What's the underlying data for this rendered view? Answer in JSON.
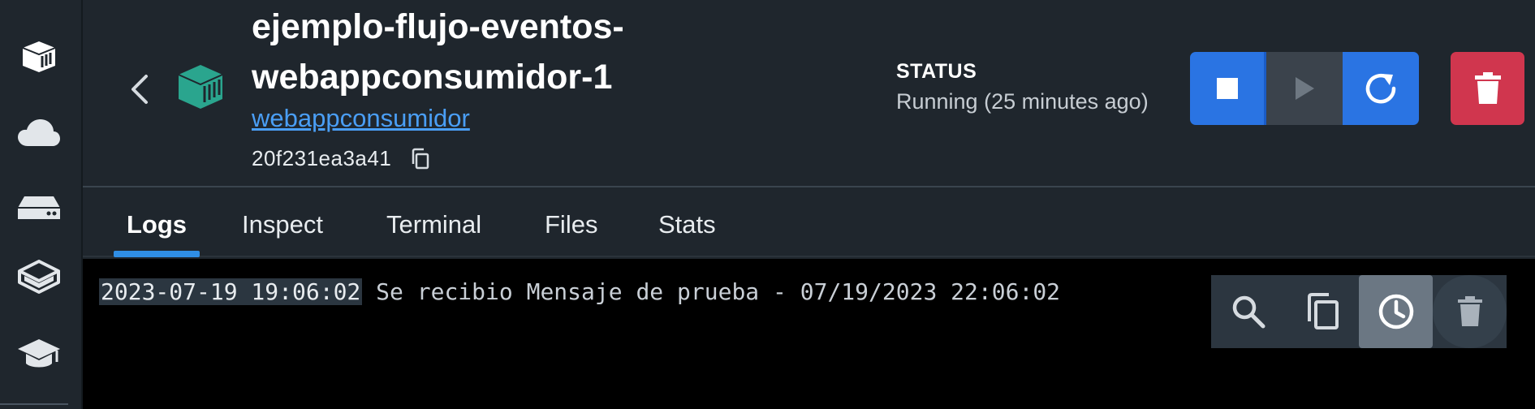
{
  "sidebar": {
    "items": [
      {
        "icon": "containers-icon"
      },
      {
        "icon": "cloud-icon"
      },
      {
        "icon": "volumes-icon"
      },
      {
        "icon": "extensions-icon"
      },
      {
        "icon": "learn-icon"
      }
    ]
  },
  "header": {
    "title_line1": "ejemplo-flujo-eventos-",
    "title_line2": "webappconsumidor-1",
    "image_link": "webappconsumidor",
    "container_id": "20f231ea3a41",
    "status_label": "STATUS",
    "status_value": "Running (25 minutes ago)"
  },
  "tabs": [
    {
      "label": "Logs",
      "active": true
    },
    {
      "label": "Inspect",
      "active": false
    },
    {
      "label": "Terminal",
      "active": false
    },
    {
      "label": "Files",
      "active": false
    },
    {
      "label": "Stats",
      "active": false
    }
  ],
  "logs": {
    "lines": [
      {
        "timestamp": "2023-07-19 19:06:02",
        "message": "Se recibio Mensaje de prueba - 07/19/2023 22:06:02"
      }
    ]
  },
  "colors": {
    "accent": "#2a74e3",
    "danger": "#d0364e",
    "container_icon": "#2aa58e",
    "link": "#4a9ef5"
  }
}
